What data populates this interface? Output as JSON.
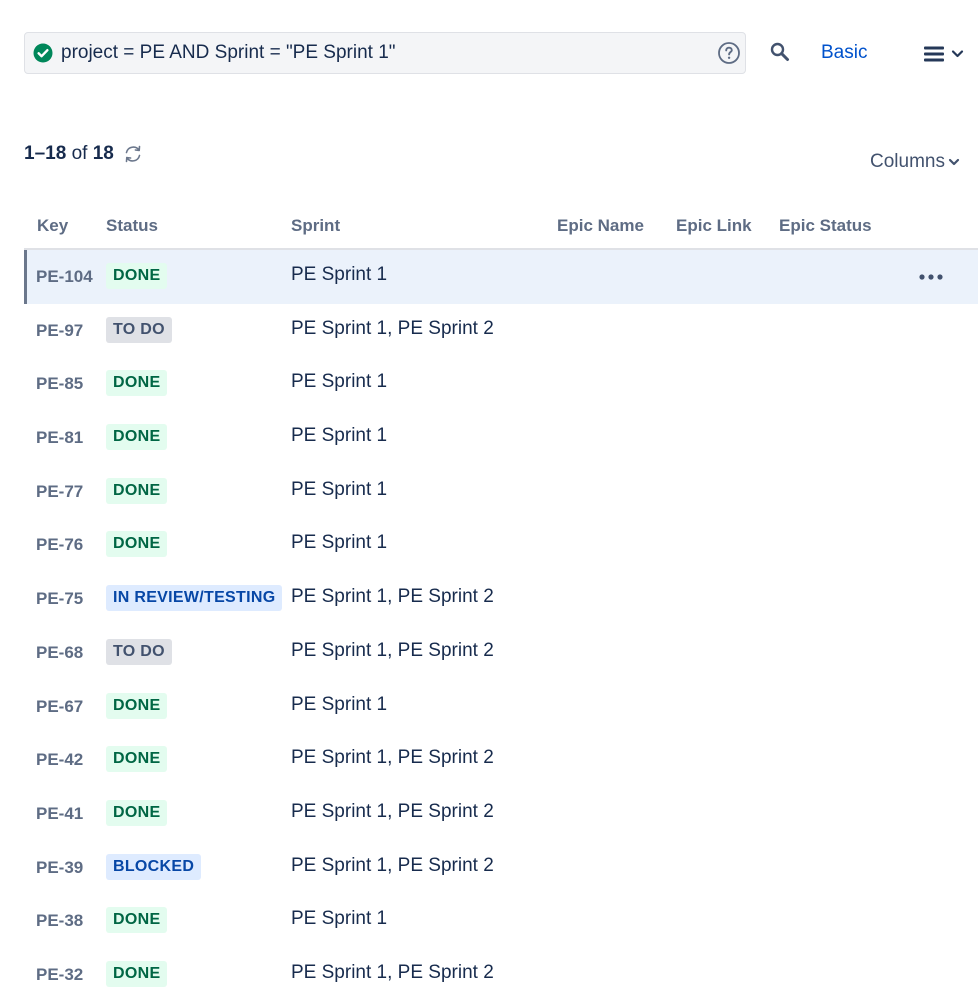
{
  "search": {
    "query": "project = PE AND Sprint = \"PE Sprint 1\"",
    "mode_toggle_label": "Basic"
  },
  "results": {
    "range": "1–18",
    "of_label": "of",
    "total": "18"
  },
  "columns_button_label": "Columns",
  "table": {
    "headers": [
      "Key",
      "Status",
      "Sprint",
      "Epic Name",
      "Epic Link",
      "Epic Status"
    ],
    "rows": [
      {
        "key": "PE-104",
        "status": "DONE",
        "sprint": "PE Sprint 1"
      },
      {
        "key": "PE-97",
        "status": "TO DO",
        "sprint": "PE Sprint 1, PE Sprint 2"
      },
      {
        "key": "PE-85",
        "status": "DONE",
        "sprint": "PE Sprint 1"
      },
      {
        "key": "PE-81",
        "status": "DONE",
        "sprint": "PE Sprint 1"
      },
      {
        "key": "PE-77",
        "status": "DONE",
        "sprint": "PE Sprint 1"
      },
      {
        "key": "PE-76",
        "status": "DONE",
        "sprint": "PE Sprint 1"
      },
      {
        "key": "PE-75",
        "status": "IN REVIEW/TESTING",
        "sprint": "PE Sprint 1, PE Sprint 2"
      },
      {
        "key": "PE-68",
        "status": "TO DO",
        "sprint": "PE Sprint 1, PE Sprint 2"
      },
      {
        "key": "PE-67",
        "status": "DONE",
        "sprint": "PE Sprint 1"
      },
      {
        "key": "PE-42",
        "status": "DONE",
        "sprint": "PE Sprint 1, PE Sprint 2"
      },
      {
        "key": "PE-41",
        "status": "DONE",
        "sprint": "PE Sprint 1, PE Sprint 2"
      },
      {
        "key": "PE-39",
        "status": "BLOCKED",
        "sprint": "PE Sprint 1, PE Sprint 2"
      },
      {
        "key": "PE-38",
        "status": "DONE",
        "sprint": "PE Sprint 1"
      },
      {
        "key": "PE-32",
        "status": "DONE",
        "sprint": "PE Sprint 1, PE Sprint 2"
      }
    ]
  },
  "status_colors": {
    "DONE": "#006644",
    "TO DO": "#42526e",
    "IN REVIEW/TESTING": "#0747a6",
    "BLOCKED": "#0747a6"
  },
  "icons": {
    "query_valid": "check-circle-icon",
    "help": "question-circle-icon",
    "search": "search-icon",
    "menu": "hamburger-menu-icon",
    "refresh": "refresh-icon",
    "columns_chevron": "chevron-down-icon",
    "row_actions": "more-horizontal-icon"
  },
  "selected_row_key": "PE-104",
  "accent_color": "#0052cc"
}
